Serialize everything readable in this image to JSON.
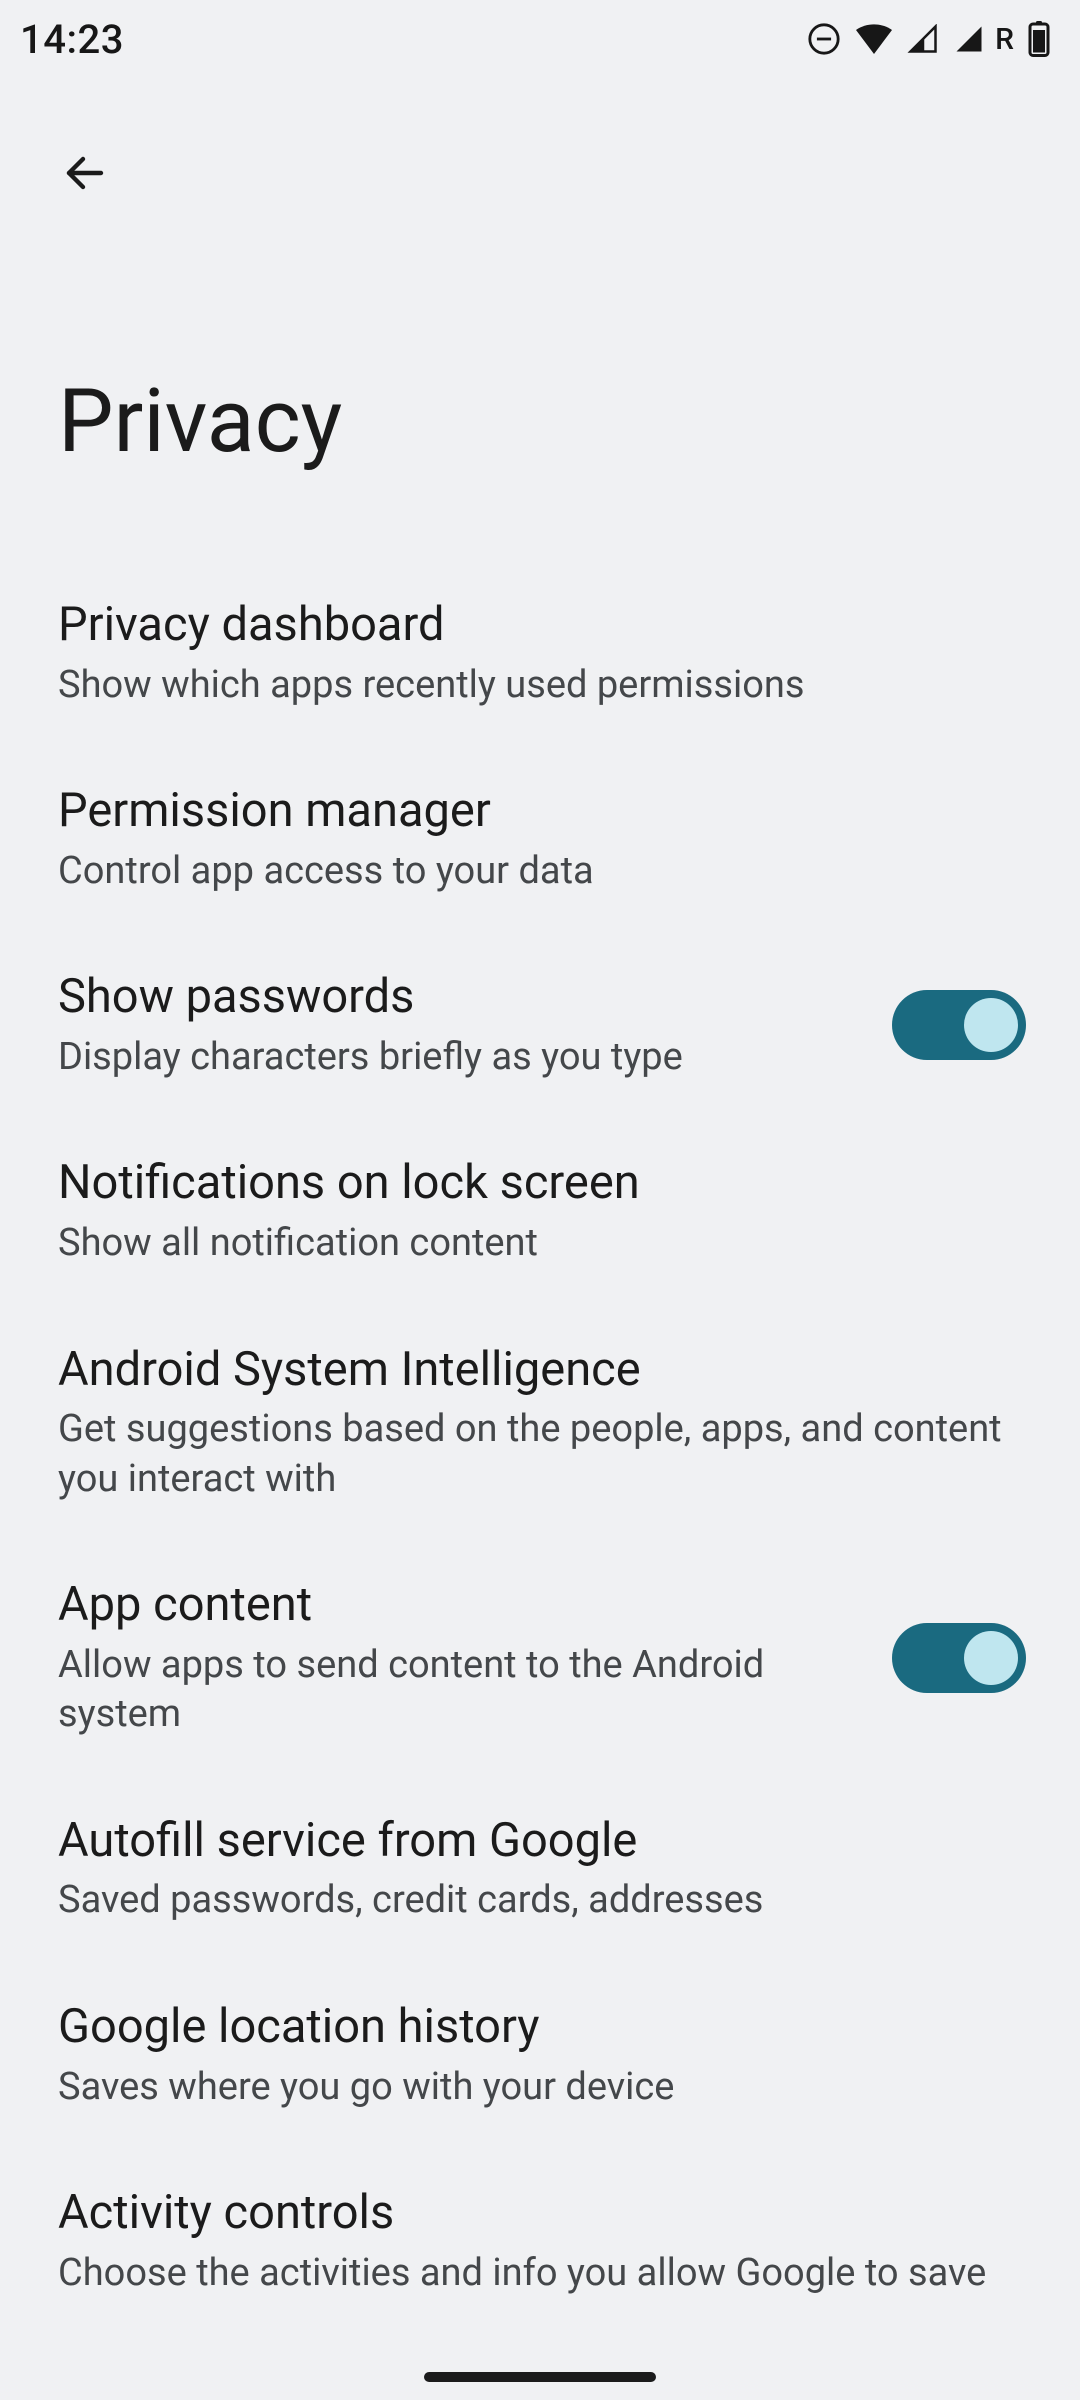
{
  "status": {
    "time": "14:23",
    "roaming": "R"
  },
  "header": {
    "title": "Privacy"
  },
  "settings": [
    {
      "title": "Privacy dashboard",
      "sub": "Show which apps recently used permissions",
      "toggle": null
    },
    {
      "title": "Permission manager",
      "sub": "Control app access to your data",
      "toggle": null
    },
    {
      "title": "Show passwords",
      "sub": "Display characters briefly as you type",
      "toggle": true
    },
    {
      "title": "Notifications on lock screen",
      "sub": "Show all notification content",
      "toggle": null
    },
    {
      "title": "Android System Intelligence",
      "sub": "Get suggestions based on the people, apps, and content you interact with",
      "toggle": null
    },
    {
      "title": "App content",
      "sub": "Allow apps to send content to the Android system",
      "toggle": true
    },
    {
      "title": "Autofill service from Google",
      "sub": "Saved passwords, credit cards, addresses",
      "toggle": null
    },
    {
      "title": "Google location history",
      "sub": "Saves where you go with your device",
      "toggle": null
    },
    {
      "title": "Activity controls",
      "sub": "Choose the activities and info you allow Google to save",
      "toggle": null
    }
  ]
}
